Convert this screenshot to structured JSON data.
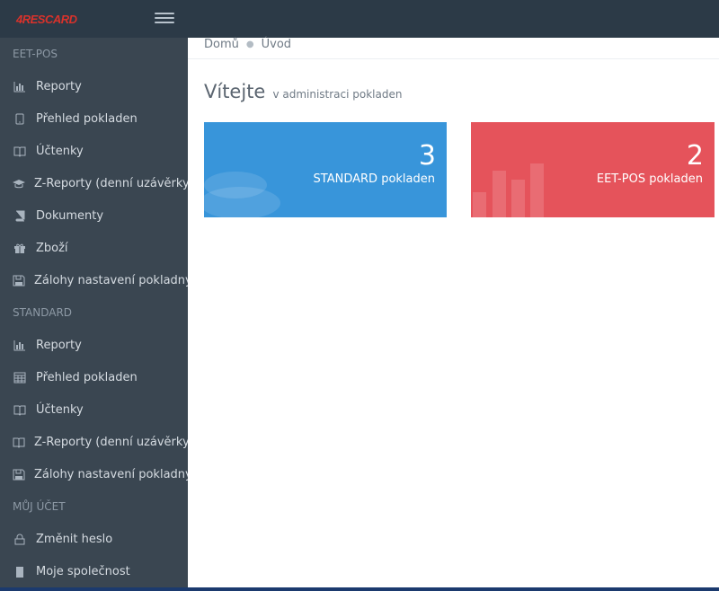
{
  "brand": {
    "logo_text": "4RESCARD"
  },
  "sidebar": {
    "sections": [
      {
        "title": "EET-POS",
        "items": [
          {
            "label": "Reporty",
            "icon": "bar-chart-icon"
          },
          {
            "label": "Přehled pokladen",
            "icon": "tablet-icon"
          },
          {
            "label": "Účtenky",
            "icon": "book-icon"
          },
          {
            "label": "Z-Reporty (denní uzávěrky)",
            "icon": "graduation-cap-icon"
          },
          {
            "label": "Dokumenty",
            "icon": "document-book-icon"
          },
          {
            "label": "Zboží",
            "icon": "gift-icon"
          },
          {
            "label": "Zálohy nastavení pokladny",
            "icon": "floppy-disk-icon"
          }
        ]
      },
      {
        "title": "STANDARD",
        "items": [
          {
            "label": "Reporty",
            "icon": "bar-chart-icon"
          },
          {
            "label": "Přehled pokladen",
            "icon": "calculator-icon"
          },
          {
            "label": "Účtenky",
            "icon": "book-icon"
          },
          {
            "label": "Z-Reporty (denní uzávěrky)",
            "icon": "book-icon"
          },
          {
            "label": "Zálohy nastavení pokladny",
            "icon": "floppy-disk-icon"
          }
        ]
      },
      {
        "title": "MŮJ ÚČET",
        "items": [
          {
            "label": "Změnit heslo",
            "icon": "lock-icon"
          },
          {
            "label": "Moje společnost",
            "icon": "building-icon"
          }
        ]
      }
    ]
  },
  "breadcrumb": {
    "home": "Domů",
    "current": "Úvod"
  },
  "welcome": {
    "title": "Vítejte",
    "subtitle": "v administraci pokladen"
  },
  "cards": [
    {
      "value": "3",
      "label": "STANDARD pokladen",
      "color": "#3895da"
    },
    {
      "value": "2",
      "label": "EET-POS pokladen",
      "color": "#e5535b"
    }
  ],
  "colors": {
    "topbar": "#2c3a47",
    "sidebar": "#3a4651",
    "accent_blue": "#3895da",
    "accent_red": "#e5535b"
  }
}
